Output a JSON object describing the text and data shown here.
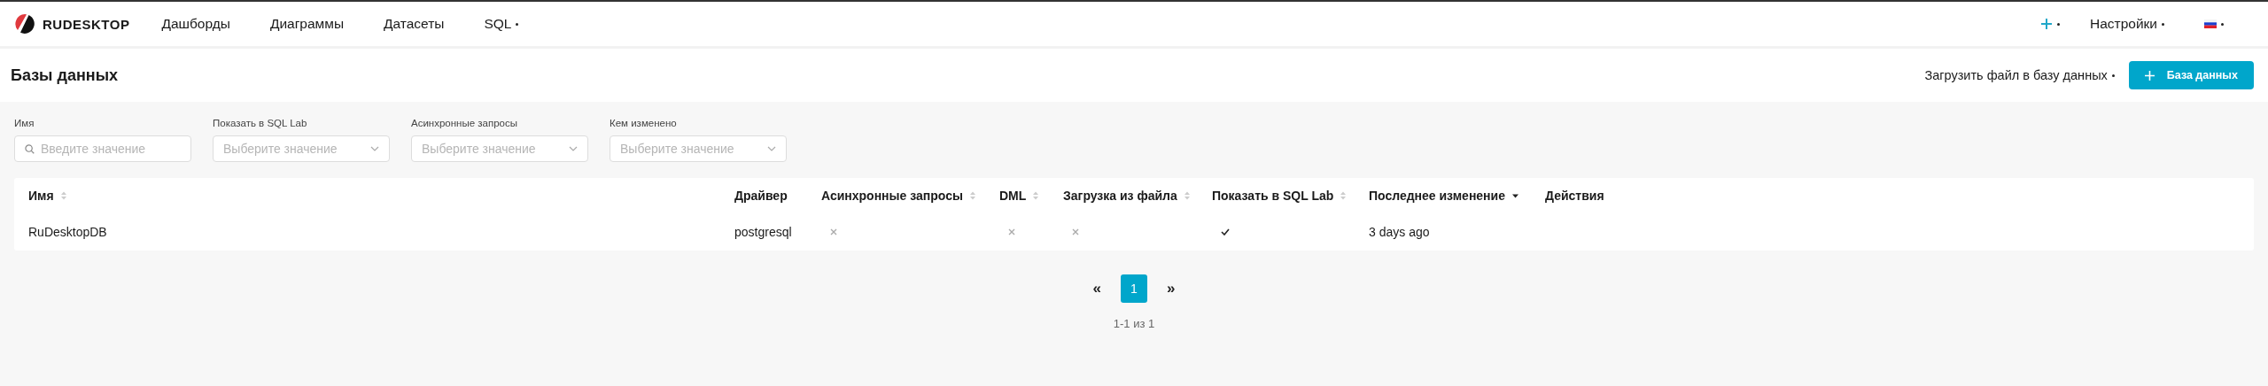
{
  "brand": {
    "name": "RUDESKTOP"
  },
  "nav": [
    {
      "label": "Дашборды",
      "dropdown": false
    },
    {
      "label": "Диаграммы",
      "dropdown": false
    },
    {
      "label": "Датасеты",
      "dropdown": false
    },
    {
      "label": "SQL",
      "dropdown": true
    }
  ],
  "right_menu": {
    "settings": "Настройки"
  },
  "page": {
    "title": "Базы данных",
    "upload": "Загрузить файл в базу данных",
    "add_button": "База данных"
  },
  "filters": [
    {
      "label": "Имя",
      "kind": "search",
      "placeholder": "Введите значение"
    },
    {
      "label": "Показать в SQL Lab",
      "kind": "select",
      "placeholder": "Выберите значение"
    },
    {
      "label": "Асинхронные запросы",
      "kind": "select",
      "placeholder": "Выберите значение"
    },
    {
      "label": "Кем изменено",
      "kind": "select",
      "placeholder": "Выберите значение"
    }
  ],
  "table": {
    "columns": [
      {
        "label": "Имя",
        "sortable": true,
        "sorted_descending": false
      },
      {
        "label": "Драйвер",
        "sortable": false
      },
      {
        "label": "Асинхронные запросы",
        "sortable": true,
        "sorted_descending": false
      },
      {
        "label": "DML",
        "sortable": true,
        "sorted_descending": false
      },
      {
        "label": "Загрузка из файла",
        "sortable": true,
        "sorted_descending": false
      },
      {
        "label": "Показать в SQL Lab",
        "sortable": true,
        "sorted_descending": false
      },
      {
        "label": "Последнее изменение",
        "sortable": true,
        "sorted_descending": true
      },
      {
        "label": "Действия",
        "sortable": false
      }
    ],
    "rows": [
      {
        "name": "RuDesktopDB",
        "driver": "postgresql",
        "async": false,
        "dml": false,
        "upload": false,
        "sql_lab": true,
        "changed": "3 days ago"
      }
    ]
  },
  "pagination": {
    "prev": "«",
    "pages": [
      {
        "label": "1",
        "selected": true
      }
    ],
    "next": "»",
    "summary": "1-1 из 1"
  }
}
